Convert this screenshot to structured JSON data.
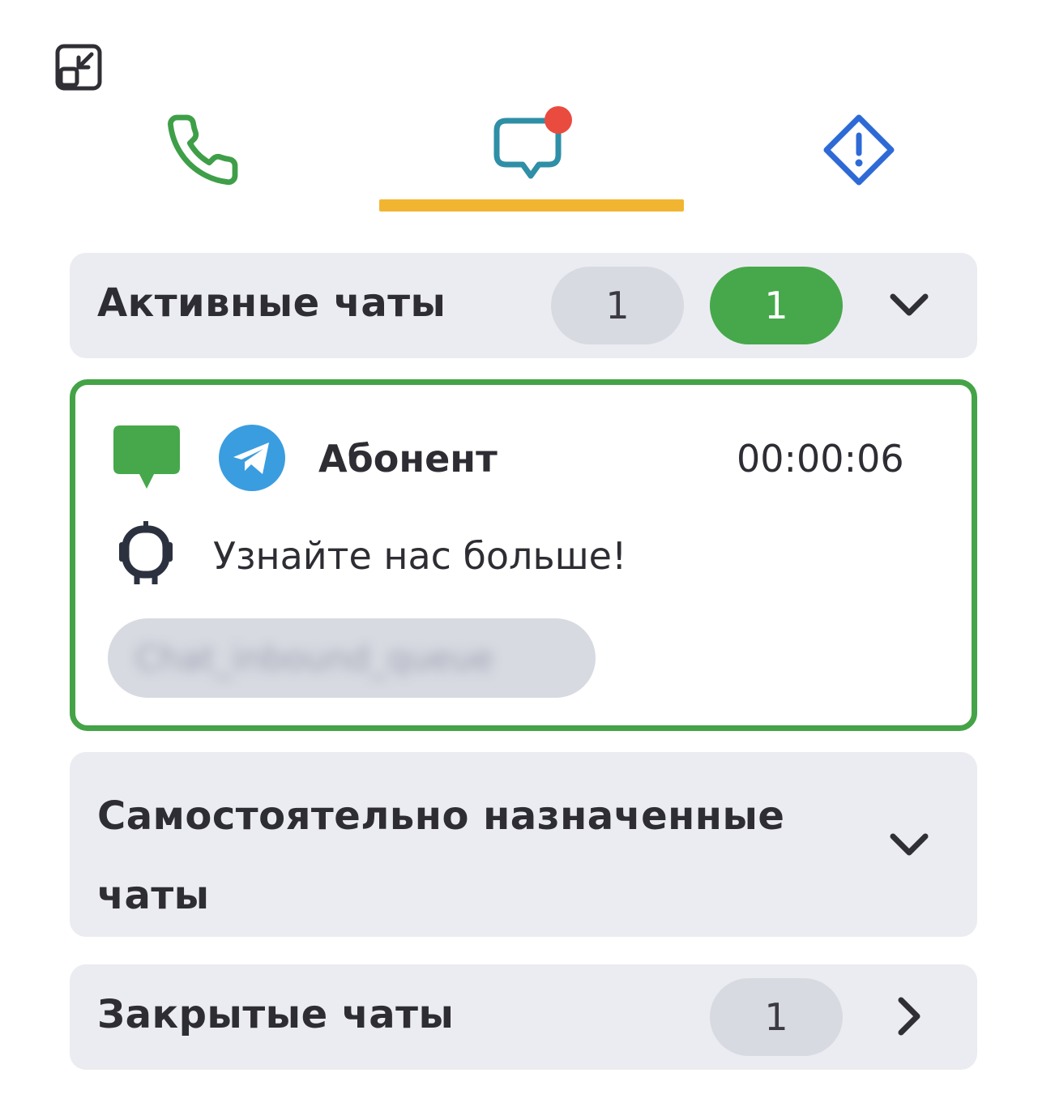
{
  "toolbar": {
    "collapse_icon": "collapse-window-icon"
  },
  "tabs": [
    {
      "name": "calls",
      "icon": "phone-icon",
      "color": "#3e9f48",
      "active": false
    },
    {
      "name": "chats",
      "icon": "chat-bubble-icon",
      "color": "#2f8fa6",
      "active": true,
      "has_notification": true
    },
    {
      "name": "alerts",
      "icon": "warning-diamond-icon",
      "color": "#2e6ad6",
      "active": false
    }
  ],
  "colors": {
    "active_underline": "#f2b532",
    "notification": "#ea4b3f",
    "green": "#46a84b",
    "card_border": "#44a347"
  },
  "sections": {
    "active": {
      "title": "Активные чаты",
      "count_grey": "1",
      "count_green": "1",
      "expanded": true
    },
    "self_assigned": {
      "title": "Самостоятельно назначенные чаты",
      "expanded": false
    },
    "closed": {
      "title": "Закрытые чаты",
      "count": "1",
      "expanded": false
    }
  },
  "chat": {
    "contact": "Абонент",
    "timer": "00:00:06",
    "message": "Узнайте нас больше!",
    "queue": "Chat_inbound_queue",
    "channel_icon": "telegram-icon",
    "status_icon": "chat-status-icon",
    "sender_icon": "bot-icon"
  }
}
